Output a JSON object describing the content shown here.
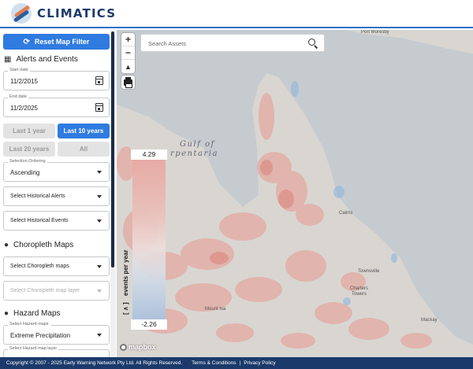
{
  "header": {
    "app_name": "CLIMATICS"
  },
  "sidebar": {
    "reset_button": "Reset Map Filter",
    "alerts_section": {
      "title": "Alerts and Events",
      "icon": "calendar-icon"
    },
    "start_date": {
      "label": "Start date",
      "value": "11/2/2015"
    },
    "end_date": {
      "label": "End date",
      "value": "11/2/2025"
    },
    "range_buttons": [
      "Last 1 year",
      "Last 10 years",
      "Last 20 years",
      "All"
    ],
    "range_selected": "Last 10 years",
    "ordering": {
      "label": "Selection Ordering",
      "value": "Ascending"
    },
    "historical_alerts": {
      "value": "Select Historical Alerts"
    },
    "historical_events": {
      "value": "Select Historical Events"
    },
    "choropleth_section": {
      "title": "Choropleth Maps",
      "icon": "globe-icon"
    },
    "choropleth_maps": {
      "value": "Select Choropleth maps"
    },
    "choropleth_layer": {
      "value": "Select Choropleth map layer"
    },
    "hazard_section": {
      "title": "Hazard Maps",
      "icon": "globe-icon"
    },
    "hazard_maps": {
      "label": "Select Hazard maps",
      "value": "Extreme Precipitation"
    },
    "hazard_layer": {
      "label": "Select Hazard map layer"
    }
  },
  "map": {
    "search_placeholder": "Search Assets",
    "zoom_in": "+",
    "zoom_out": "−",
    "gulf_label_line1": "Gulf of",
    "gulf_label_line2": "rpentaria",
    "places": {
      "port_moresby": "Port Moresby",
      "cairns": "Cairns",
      "townsville": "Townsville",
      "charters": "Charters",
      "towers": "Towers",
      "mount_isa": "Mount Isa",
      "mackay": "Mackay"
    },
    "legend": {
      "max": "4.29",
      "min": "-2.26",
      "axis_label": "events per year",
      "toggle": "[ ∧ ]"
    },
    "attribution": "mapbox",
    "colors": {
      "land": "#d9d6d2",
      "water": "#c6cbd0",
      "hazard": "#e89a90",
      "cool": "#8db5dc"
    }
  },
  "footer": {
    "copyright": "Copyright © 2007 - 2025 Early Warning Network Pty Ltd. All Rights Reserved.",
    "terms": "Terms & Conditions",
    "separator": "|",
    "privacy": "Privacy Policy"
  }
}
